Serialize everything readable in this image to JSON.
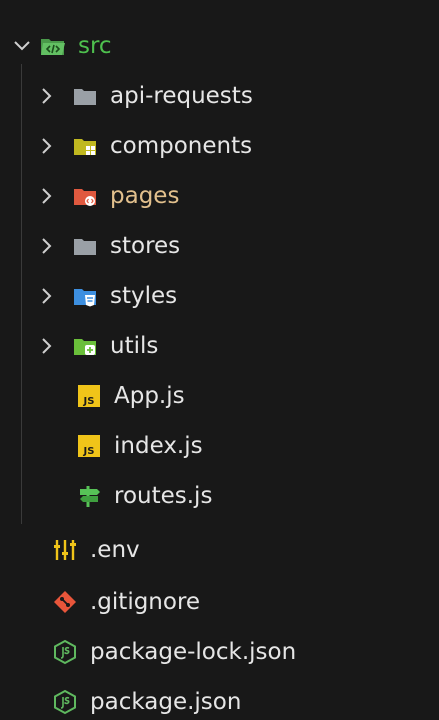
{
  "explorer": {
    "items": [
      {
        "label": "src",
        "color": "#4ec04e",
        "icon": "folder-src-open-icon",
        "chevron": "chevron-down-icon"
      },
      {
        "label": "api-requests",
        "color": "#e6e6e6",
        "icon": "folder-icon",
        "chevron": "chevron-right-icon"
      },
      {
        "label": "components",
        "color": "#e6e6e6",
        "icon": "folder-components-icon",
        "chevron": "chevron-right-icon"
      },
      {
        "label": "pages",
        "color": "#e2c08d",
        "icon": "folder-pages-icon",
        "chevron": "chevron-right-icon"
      },
      {
        "label": "stores",
        "color": "#e6e6e6",
        "icon": "folder-icon",
        "chevron": "chevron-right-icon"
      },
      {
        "label": "styles",
        "color": "#e6e6e6",
        "icon": "folder-styles-icon",
        "chevron": "chevron-right-icon"
      },
      {
        "label": "utils",
        "color": "#e6e6e6",
        "icon": "folder-utils-icon",
        "chevron": "chevron-right-icon"
      },
      {
        "label": "App.js",
        "color": "#e6e6e6",
        "icon": "javascript-file-icon"
      },
      {
        "label": "index.js",
        "color": "#e6e6e6",
        "icon": "javascript-file-icon"
      },
      {
        "label": "routes.js",
        "color": "#e6e6e6",
        "icon": "routes-file-icon"
      },
      {
        "label": ".env",
        "color": "#e6e6e6",
        "icon": "env-file-icon"
      },
      {
        "label": ".gitignore",
        "color": "#e6e6e6",
        "icon": "git-icon"
      },
      {
        "label": "package-lock.json",
        "color": "#e6e6e6",
        "icon": "nodejs-icon"
      },
      {
        "label": "package.json",
        "color": "#e6e6e6",
        "icon": "nodejs-icon"
      }
    ],
    "js_badge": "JS"
  }
}
